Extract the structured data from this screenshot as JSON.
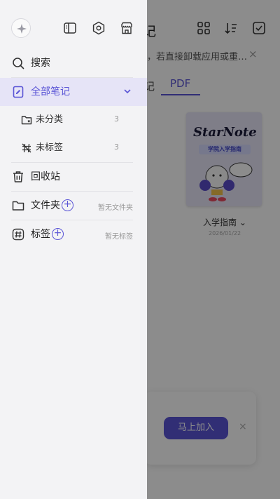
{
  "background": {
    "title_fragment": "记",
    "hint_text": "，若直接卸载应用或重…",
    "hint_close": "×",
    "tab_prefix": "记",
    "tab_active": "PDF",
    "cover": {
      "title": "StarNote",
      "banner": "学院入学指南"
    },
    "document": {
      "name": "入学指南 ⌄",
      "date": "2026/01/22"
    },
    "join_button": "马上加入",
    "banner_close": "×"
  },
  "drawer": {
    "search_label": "搜索",
    "all_notes_label": "全部笔记",
    "uncategorized_label": "未分类",
    "uncategorized_count": "3",
    "untagged_label": "未标签",
    "untagged_count": "3",
    "trash_label": "回收站",
    "folders_label": "文件夹",
    "folders_empty": "暂无文件夹",
    "tags_label": "标签",
    "tags_empty": "暂无标签"
  },
  "colors": {
    "accent": "#5a55d6",
    "active_bg": "#e6e4f7",
    "drawer_bg": "#f3f3f5"
  },
  "icons": [
    "sparkle-icon",
    "sidebar-toggle-icon",
    "settings-icon",
    "store-icon",
    "search-icon",
    "note-icon",
    "chevron-down-icon",
    "folder-icon",
    "tag-off-icon",
    "trash-icon",
    "hash-icon",
    "plus-icon",
    "grid-icon",
    "sort-icon",
    "checkbox-icon"
  ]
}
